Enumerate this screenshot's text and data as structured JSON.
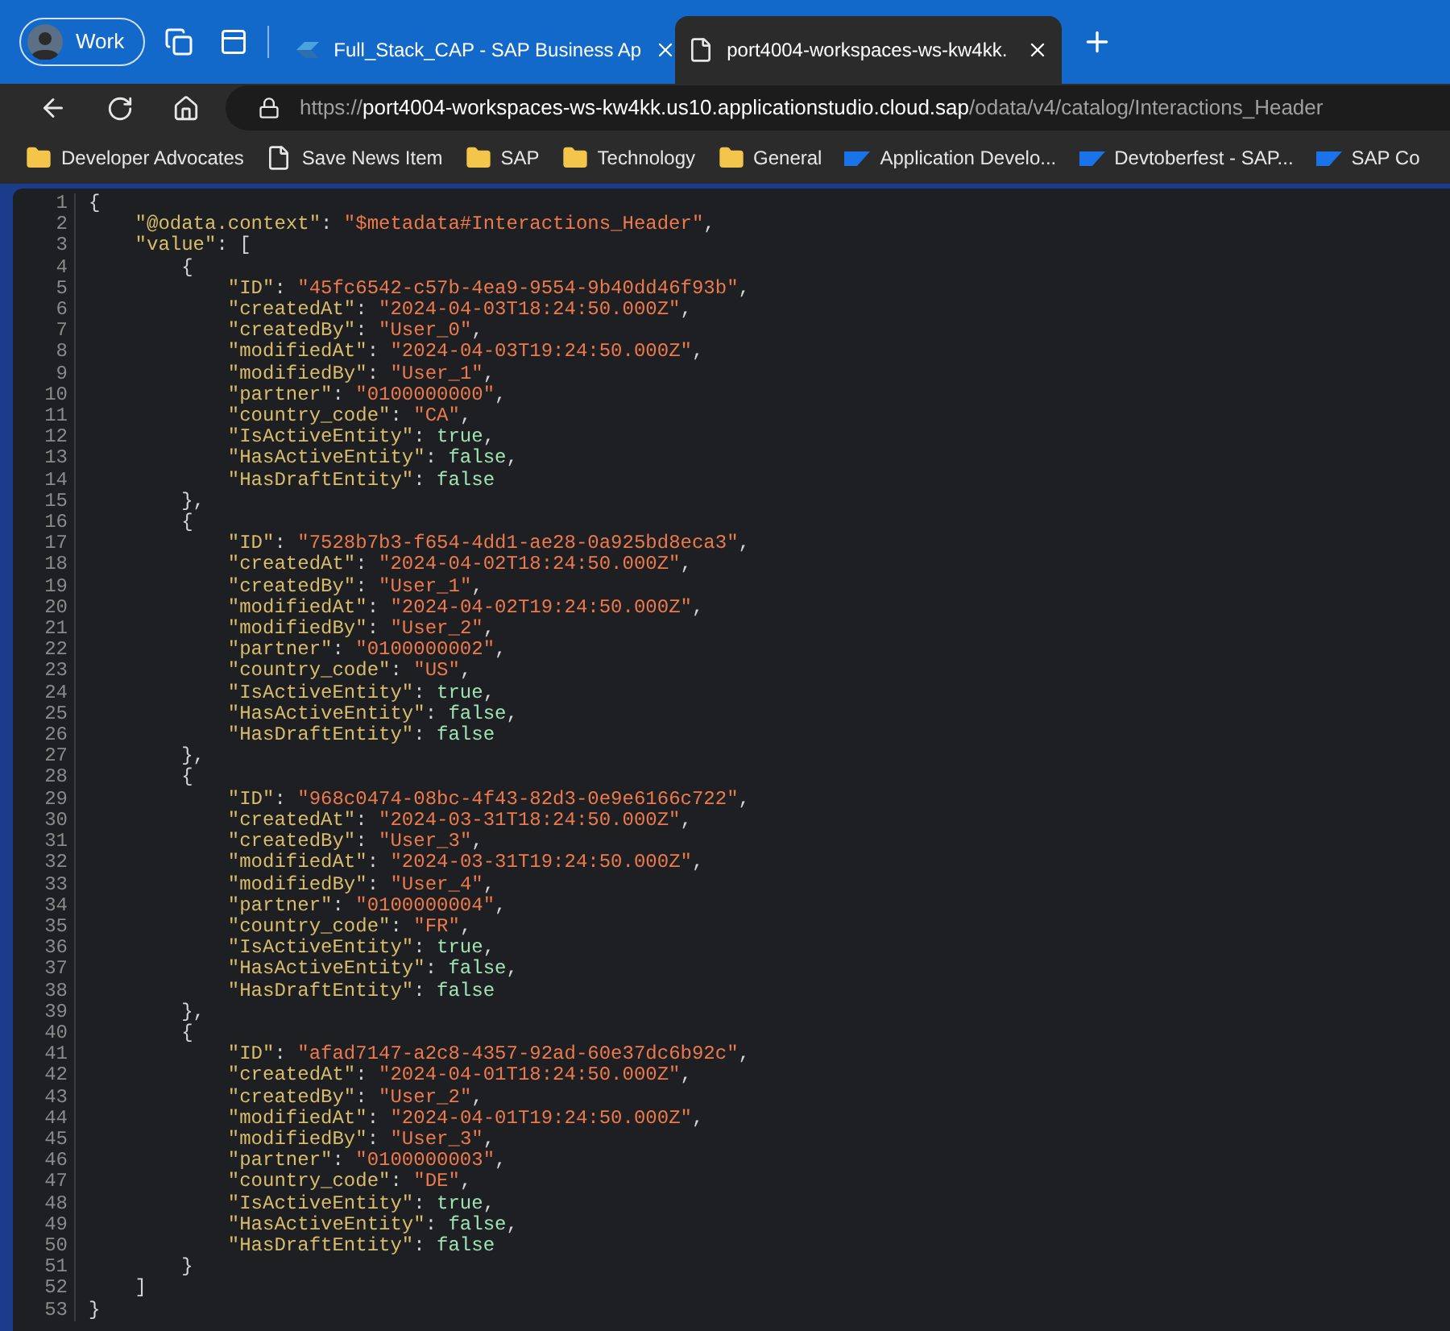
{
  "browser": {
    "profile": {
      "label": "Work"
    },
    "tabs": [
      {
        "title": "Full_Stack_CAP - SAP Business Ap",
        "kind": "app",
        "selected": false
      },
      {
        "title": "port4004-workspaces-ws-kw4kk.",
        "kind": "page",
        "selected": true
      }
    ],
    "address_bar": {
      "scheme": "https://",
      "host": "port4004-workspaces-ws-kw4kk.us10.applicationstudio.cloud.sap",
      "path": "/odata/v4/catalog/Interactions_Header"
    },
    "bookmarks": [
      {
        "label": "Developer Advocates",
        "kind": "folder"
      },
      {
        "label": "Save News Item",
        "kind": "page"
      },
      {
        "label": "SAP",
        "kind": "folder"
      },
      {
        "label": "Technology",
        "kind": "folder"
      },
      {
        "label": "General",
        "kind": "folder"
      },
      {
        "label": "Application Develo...",
        "kind": "sap"
      },
      {
        "label": "Devtoberfest - SAP...",
        "kind": "sap"
      },
      {
        "label": "SAP Co",
        "kind": "sap"
      }
    ]
  },
  "code_viewer": {
    "lines": [
      {
        "number": "1",
        "tokens": [
          {
            "kind": "punct",
            "text": "{"
          }
        ],
        "children": [
          {
            "number": "2",
            "tokens": [
              {
                "kind": "key",
                "text": "\"@odata.context\""
              },
              {
                "kind": "punct",
                "text": ": "
              },
              {
                "kind": "string",
                "text": "\"$metadata#Interactions_Header\""
              },
              {
                "kind": "punct",
                "text": ","
              }
            ]
          },
          {
            "number": "3",
            "tokens": [
              {
                "kind": "key",
                "text": "\"value\""
              },
              {
                "kind": "punct",
                "text": ": ["
              }
            ],
            "children": [
              {
                "number": "4",
                "tokens": [
                  {
                    "kind": "punct",
                    "text": "{"
                  }
                ],
                "children": [
                  {
                    "number": "5",
                    "tokens": [
                      {
                        "kind": "key",
                        "text": "\"ID\""
                      },
                      {
                        "kind": "punct",
                        "text": ": "
                      },
                      {
                        "kind": "string",
                        "text": "\"45fc6542-c57b-4ea9-9554-9b40dd46f93b\""
                      },
                      {
                        "kind": "punct",
                        "text": ","
                      }
                    ]
                  },
                  {
                    "number": "6",
                    "tokens": [
                      {
                        "kind": "key",
                        "text": "\"createdAt\""
                      },
                      {
                        "kind": "punct",
                        "text": ": "
                      },
                      {
                        "kind": "string",
                        "text": "\"2024-04-03T18:24:50.000Z\""
                      },
                      {
                        "kind": "punct",
                        "text": ","
                      }
                    ]
                  },
                  {
                    "number": "7",
                    "tokens": [
                      {
                        "kind": "key",
                        "text": "\"createdBy\""
                      },
                      {
                        "kind": "punct",
                        "text": ": "
                      },
                      {
                        "kind": "string",
                        "text": "\"User_0\""
                      },
                      {
                        "kind": "punct",
                        "text": ","
                      }
                    ]
                  },
                  {
                    "number": "8",
                    "tokens": [
                      {
                        "kind": "key",
                        "text": "\"modifiedAt\""
                      },
                      {
                        "kind": "punct",
                        "text": ": "
                      },
                      {
                        "kind": "string",
                        "text": "\"2024-04-03T19:24:50.000Z\""
                      },
                      {
                        "kind": "punct",
                        "text": ","
                      }
                    ]
                  },
                  {
                    "number": "9",
                    "tokens": [
                      {
                        "kind": "key",
                        "text": "\"modifiedBy\""
                      },
                      {
                        "kind": "punct",
                        "text": ": "
                      },
                      {
                        "kind": "string",
                        "text": "\"User_1\""
                      },
                      {
                        "kind": "punct",
                        "text": ","
                      }
                    ]
                  },
                  {
                    "number": "10",
                    "tokens": [
                      {
                        "kind": "key",
                        "text": "\"partner\""
                      },
                      {
                        "kind": "punct",
                        "text": ": "
                      },
                      {
                        "kind": "string",
                        "text": "\"0100000000\""
                      },
                      {
                        "kind": "punct",
                        "text": ","
                      }
                    ]
                  },
                  {
                    "number": "11",
                    "tokens": [
                      {
                        "kind": "key",
                        "text": "\"country_code\""
                      },
                      {
                        "kind": "punct",
                        "text": ": "
                      },
                      {
                        "kind": "string",
                        "text": "\"CA\""
                      },
                      {
                        "kind": "punct",
                        "text": ","
                      }
                    ]
                  },
                  {
                    "number": "12",
                    "tokens": [
                      {
                        "kind": "key",
                        "text": "\"IsActiveEntity\""
                      },
                      {
                        "kind": "punct",
                        "text": ": "
                      },
                      {
                        "kind": "literal",
                        "text": "true"
                      },
                      {
                        "kind": "punct",
                        "text": ","
                      }
                    ]
                  },
                  {
                    "number": "13",
                    "tokens": [
                      {
                        "kind": "key",
                        "text": "\"HasActiveEntity\""
                      },
                      {
                        "kind": "punct",
                        "text": ": "
                      },
                      {
                        "kind": "literal",
                        "text": "false"
                      },
                      {
                        "kind": "punct",
                        "text": ","
                      }
                    ]
                  },
                  {
                    "number": "14",
                    "tokens": [
                      {
                        "kind": "key",
                        "text": "\"HasDraftEntity\""
                      },
                      {
                        "kind": "punct",
                        "text": ": "
                      },
                      {
                        "kind": "literal",
                        "text": "false"
                      }
                    ]
                  }
                ]
              },
              {
                "number": "15",
                "tokens": [
                  {
                    "kind": "punct",
                    "text": "},"
                  }
                ]
              },
              {
                "number": "16",
                "tokens": [
                  {
                    "kind": "punct",
                    "text": "{"
                  }
                ],
                "children": [
                  {
                    "number": "17",
                    "tokens": [
                      {
                        "kind": "key",
                        "text": "\"ID\""
                      },
                      {
                        "kind": "punct",
                        "text": ": "
                      },
                      {
                        "kind": "string",
                        "text": "\"7528b7b3-f654-4dd1-ae28-0a925bd8eca3\""
                      },
                      {
                        "kind": "punct",
                        "text": ","
                      }
                    ]
                  },
                  {
                    "number": "18",
                    "tokens": [
                      {
                        "kind": "key",
                        "text": "\"createdAt\""
                      },
                      {
                        "kind": "punct",
                        "text": ": "
                      },
                      {
                        "kind": "string",
                        "text": "\"2024-04-02T18:24:50.000Z\""
                      },
                      {
                        "kind": "punct",
                        "text": ","
                      }
                    ]
                  },
                  {
                    "number": "19",
                    "tokens": [
                      {
                        "kind": "key",
                        "text": "\"createdBy\""
                      },
                      {
                        "kind": "punct",
                        "text": ": "
                      },
                      {
                        "kind": "string",
                        "text": "\"User_1\""
                      },
                      {
                        "kind": "punct",
                        "text": ","
                      }
                    ]
                  },
                  {
                    "number": "20",
                    "tokens": [
                      {
                        "kind": "key",
                        "text": "\"modifiedAt\""
                      },
                      {
                        "kind": "punct",
                        "text": ": "
                      },
                      {
                        "kind": "string",
                        "text": "\"2024-04-02T19:24:50.000Z\""
                      },
                      {
                        "kind": "punct",
                        "text": ","
                      }
                    ]
                  },
                  {
                    "number": "21",
                    "tokens": [
                      {
                        "kind": "key",
                        "text": "\"modifiedBy\""
                      },
                      {
                        "kind": "punct",
                        "text": ": "
                      },
                      {
                        "kind": "string",
                        "text": "\"User_2\""
                      },
                      {
                        "kind": "punct",
                        "text": ","
                      }
                    ]
                  },
                  {
                    "number": "22",
                    "tokens": [
                      {
                        "kind": "key",
                        "text": "\"partner\""
                      },
                      {
                        "kind": "punct",
                        "text": ": "
                      },
                      {
                        "kind": "string",
                        "text": "\"0100000002\""
                      },
                      {
                        "kind": "punct",
                        "text": ","
                      }
                    ]
                  },
                  {
                    "number": "23",
                    "tokens": [
                      {
                        "kind": "key",
                        "text": "\"country_code\""
                      },
                      {
                        "kind": "punct",
                        "text": ": "
                      },
                      {
                        "kind": "string",
                        "text": "\"US\""
                      },
                      {
                        "kind": "punct",
                        "text": ","
                      }
                    ]
                  },
                  {
                    "number": "24",
                    "tokens": [
                      {
                        "kind": "key",
                        "text": "\"IsActiveEntity\""
                      },
                      {
                        "kind": "punct",
                        "text": ": "
                      },
                      {
                        "kind": "literal",
                        "text": "true"
                      },
                      {
                        "kind": "punct",
                        "text": ","
                      }
                    ]
                  },
                  {
                    "number": "25",
                    "tokens": [
                      {
                        "kind": "key",
                        "text": "\"HasActiveEntity\""
                      },
                      {
                        "kind": "punct",
                        "text": ": "
                      },
                      {
                        "kind": "literal",
                        "text": "false"
                      },
                      {
                        "kind": "punct",
                        "text": ","
                      }
                    ]
                  },
                  {
                    "number": "26",
                    "tokens": [
                      {
                        "kind": "key",
                        "text": "\"HasDraftEntity\""
                      },
                      {
                        "kind": "punct",
                        "text": ": "
                      },
                      {
                        "kind": "literal",
                        "text": "false"
                      }
                    ]
                  }
                ]
              },
              {
                "number": "27",
                "tokens": [
                  {
                    "kind": "punct",
                    "text": "},"
                  }
                ]
              },
              {
                "number": "28",
                "tokens": [
                  {
                    "kind": "punct",
                    "text": "{"
                  }
                ],
                "children": [
                  {
                    "number": "29",
                    "tokens": [
                      {
                        "kind": "key",
                        "text": "\"ID\""
                      },
                      {
                        "kind": "punct",
                        "text": ": "
                      },
                      {
                        "kind": "string",
                        "text": "\"968c0474-08bc-4f43-82d3-0e9e6166c722\""
                      },
                      {
                        "kind": "punct",
                        "text": ","
                      }
                    ]
                  },
                  {
                    "number": "30",
                    "tokens": [
                      {
                        "kind": "key",
                        "text": "\"createdAt\""
                      },
                      {
                        "kind": "punct",
                        "text": ": "
                      },
                      {
                        "kind": "string",
                        "text": "\"2024-03-31T18:24:50.000Z\""
                      },
                      {
                        "kind": "punct",
                        "text": ","
                      }
                    ]
                  },
                  {
                    "number": "31",
                    "tokens": [
                      {
                        "kind": "key",
                        "text": "\"createdBy\""
                      },
                      {
                        "kind": "punct",
                        "text": ": "
                      },
                      {
                        "kind": "string",
                        "text": "\"User_3\""
                      },
                      {
                        "kind": "punct",
                        "text": ","
                      }
                    ]
                  },
                  {
                    "number": "32",
                    "tokens": [
                      {
                        "kind": "key",
                        "text": "\"modifiedAt\""
                      },
                      {
                        "kind": "punct",
                        "text": ": "
                      },
                      {
                        "kind": "string",
                        "text": "\"2024-03-31T19:24:50.000Z\""
                      },
                      {
                        "kind": "punct",
                        "text": ","
                      }
                    ]
                  },
                  {
                    "number": "33",
                    "tokens": [
                      {
                        "kind": "key",
                        "text": "\"modifiedBy\""
                      },
                      {
                        "kind": "punct",
                        "text": ": "
                      },
                      {
                        "kind": "string",
                        "text": "\"User_4\""
                      },
                      {
                        "kind": "punct",
                        "text": ","
                      }
                    ]
                  },
                  {
                    "number": "34",
                    "tokens": [
                      {
                        "kind": "key",
                        "text": "\"partner\""
                      },
                      {
                        "kind": "punct",
                        "text": ": "
                      },
                      {
                        "kind": "string",
                        "text": "\"0100000004\""
                      },
                      {
                        "kind": "punct",
                        "text": ","
                      }
                    ]
                  },
                  {
                    "number": "35",
                    "tokens": [
                      {
                        "kind": "key",
                        "text": "\"country_code\""
                      },
                      {
                        "kind": "punct",
                        "text": ": "
                      },
                      {
                        "kind": "string",
                        "text": "\"FR\""
                      },
                      {
                        "kind": "punct",
                        "text": ","
                      }
                    ]
                  },
                  {
                    "number": "36",
                    "tokens": [
                      {
                        "kind": "key",
                        "text": "\"IsActiveEntity\""
                      },
                      {
                        "kind": "punct",
                        "text": ": "
                      },
                      {
                        "kind": "literal",
                        "text": "true"
                      },
                      {
                        "kind": "punct",
                        "text": ","
                      }
                    ]
                  },
                  {
                    "number": "37",
                    "tokens": [
                      {
                        "kind": "key",
                        "text": "\"HasActiveEntity\""
                      },
                      {
                        "kind": "punct",
                        "text": ": "
                      },
                      {
                        "kind": "literal",
                        "text": "false"
                      },
                      {
                        "kind": "punct",
                        "text": ","
                      }
                    ]
                  },
                  {
                    "number": "38",
                    "tokens": [
                      {
                        "kind": "key",
                        "text": "\"HasDraftEntity\""
                      },
                      {
                        "kind": "punct",
                        "text": ": "
                      },
                      {
                        "kind": "literal",
                        "text": "false"
                      }
                    ]
                  }
                ]
              },
              {
                "number": "39",
                "tokens": [
                  {
                    "kind": "punct",
                    "text": "},"
                  }
                ]
              },
              {
                "number": "40",
                "tokens": [
                  {
                    "kind": "punct",
                    "text": "{"
                  }
                ],
                "children": [
                  {
                    "number": "41",
                    "tokens": [
                      {
                        "kind": "key",
                        "text": "\"ID\""
                      },
                      {
                        "kind": "punct",
                        "text": ": "
                      },
                      {
                        "kind": "string",
                        "text": "\"afad7147-a2c8-4357-92ad-60e37dc6b92c\""
                      },
                      {
                        "kind": "punct",
                        "text": ","
                      }
                    ]
                  },
                  {
                    "number": "42",
                    "tokens": [
                      {
                        "kind": "key",
                        "text": "\"createdAt\""
                      },
                      {
                        "kind": "punct",
                        "text": ": "
                      },
                      {
                        "kind": "string",
                        "text": "\"2024-04-01T18:24:50.000Z\""
                      },
                      {
                        "kind": "punct",
                        "text": ","
                      }
                    ]
                  },
                  {
                    "number": "43",
                    "tokens": [
                      {
                        "kind": "key",
                        "text": "\"createdBy\""
                      },
                      {
                        "kind": "punct",
                        "text": ": "
                      },
                      {
                        "kind": "string",
                        "text": "\"User_2\""
                      },
                      {
                        "kind": "punct",
                        "text": ","
                      }
                    ]
                  },
                  {
                    "number": "44",
                    "tokens": [
                      {
                        "kind": "key",
                        "text": "\"modifiedAt\""
                      },
                      {
                        "kind": "punct",
                        "text": ": "
                      },
                      {
                        "kind": "string",
                        "text": "\"2024-04-01T19:24:50.000Z\""
                      },
                      {
                        "kind": "punct",
                        "text": ","
                      }
                    ]
                  },
                  {
                    "number": "45",
                    "tokens": [
                      {
                        "kind": "key",
                        "text": "\"modifiedBy\""
                      },
                      {
                        "kind": "punct",
                        "text": ": "
                      },
                      {
                        "kind": "string",
                        "text": "\"User_3\""
                      },
                      {
                        "kind": "punct",
                        "text": ","
                      }
                    ]
                  },
                  {
                    "number": "46",
                    "tokens": [
                      {
                        "kind": "key",
                        "text": "\"partner\""
                      },
                      {
                        "kind": "punct",
                        "text": ": "
                      },
                      {
                        "kind": "string",
                        "text": "\"0100000003\""
                      },
                      {
                        "kind": "punct",
                        "text": ","
                      }
                    ]
                  },
                  {
                    "number": "47",
                    "tokens": [
                      {
                        "kind": "key",
                        "text": "\"country_code\""
                      },
                      {
                        "kind": "punct",
                        "text": ": "
                      },
                      {
                        "kind": "string",
                        "text": "\"DE\""
                      },
                      {
                        "kind": "punct",
                        "text": ","
                      }
                    ]
                  },
                  {
                    "number": "48",
                    "tokens": [
                      {
                        "kind": "key",
                        "text": "\"IsActiveEntity\""
                      },
                      {
                        "kind": "punct",
                        "text": ": "
                      },
                      {
                        "kind": "literal",
                        "text": "true"
                      },
                      {
                        "kind": "punct",
                        "text": ","
                      }
                    ]
                  },
                  {
                    "number": "49",
                    "tokens": [
                      {
                        "kind": "key",
                        "text": "\"HasActiveEntity\""
                      },
                      {
                        "kind": "punct",
                        "text": ": "
                      },
                      {
                        "kind": "literal",
                        "text": "false"
                      },
                      {
                        "kind": "punct",
                        "text": ","
                      }
                    ]
                  },
                  {
                    "number": "50",
                    "tokens": [
                      {
                        "kind": "key",
                        "text": "\"HasDraftEntity\""
                      },
                      {
                        "kind": "punct",
                        "text": ": "
                      },
                      {
                        "kind": "literal",
                        "text": "false"
                      }
                    ]
                  }
                ]
              },
              {
                "number": "51",
                "tokens": [
                  {
                    "kind": "punct",
                    "text": "}"
                  }
                ]
              }
            ]
          },
          {
            "number": "52",
            "tokens": [
              {
                "kind": "punct",
                "text": "]"
              }
            ]
          }
        ]
      },
      {
        "number": "53",
        "tokens": [
          {
            "kind": "punct",
            "text": "}"
          }
        ]
      }
    ]
  }
}
